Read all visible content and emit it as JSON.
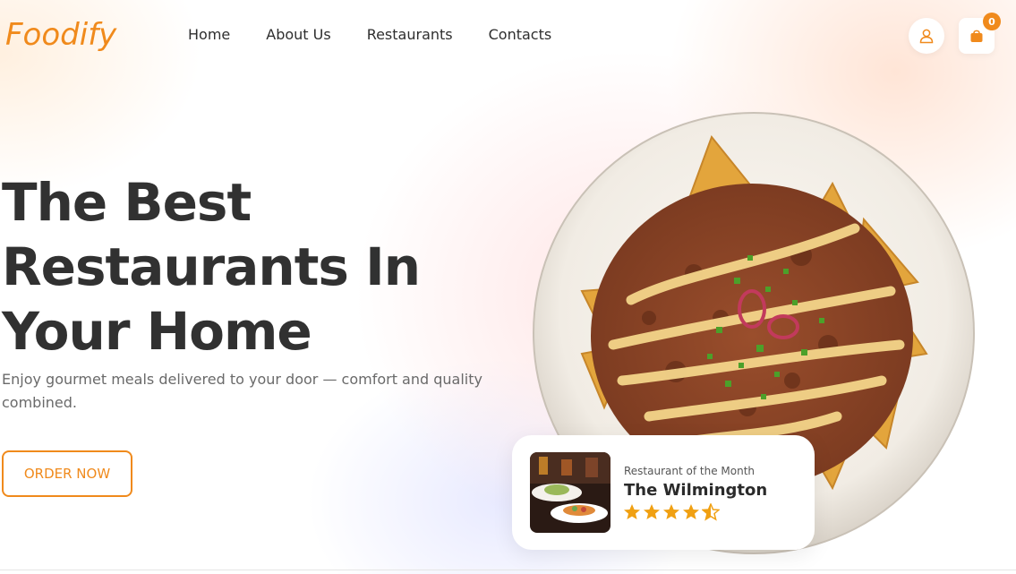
{
  "brand": {
    "name": "Foodify",
    "color": "#f08a1c"
  },
  "nav": {
    "items": [
      "Home",
      "About Us",
      "Restaurants",
      "Contacts"
    ]
  },
  "header": {
    "user_icon": "user-icon",
    "cart_icon": "shopping-bag-icon",
    "cart_count": "0"
  },
  "hero": {
    "title_lines": [
      "The Best",
      "Restaurants In",
      "Your Home"
    ],
    "subtitle": "Enjoy gourmet meals delivered to your door — comfort and quality combined.",
    "cta_label": "ORDER NOW"
  },
  "featured": {
    "label": "Restaurant of the Month",
    "name": "The Wilmington",
    "rating": 4.5,
    "rating_max": 5
  },
  "colors": {
    "accent": "#f08a1c",
    "heading": "#313131",
    "star": "#f0a012"
  }
}
